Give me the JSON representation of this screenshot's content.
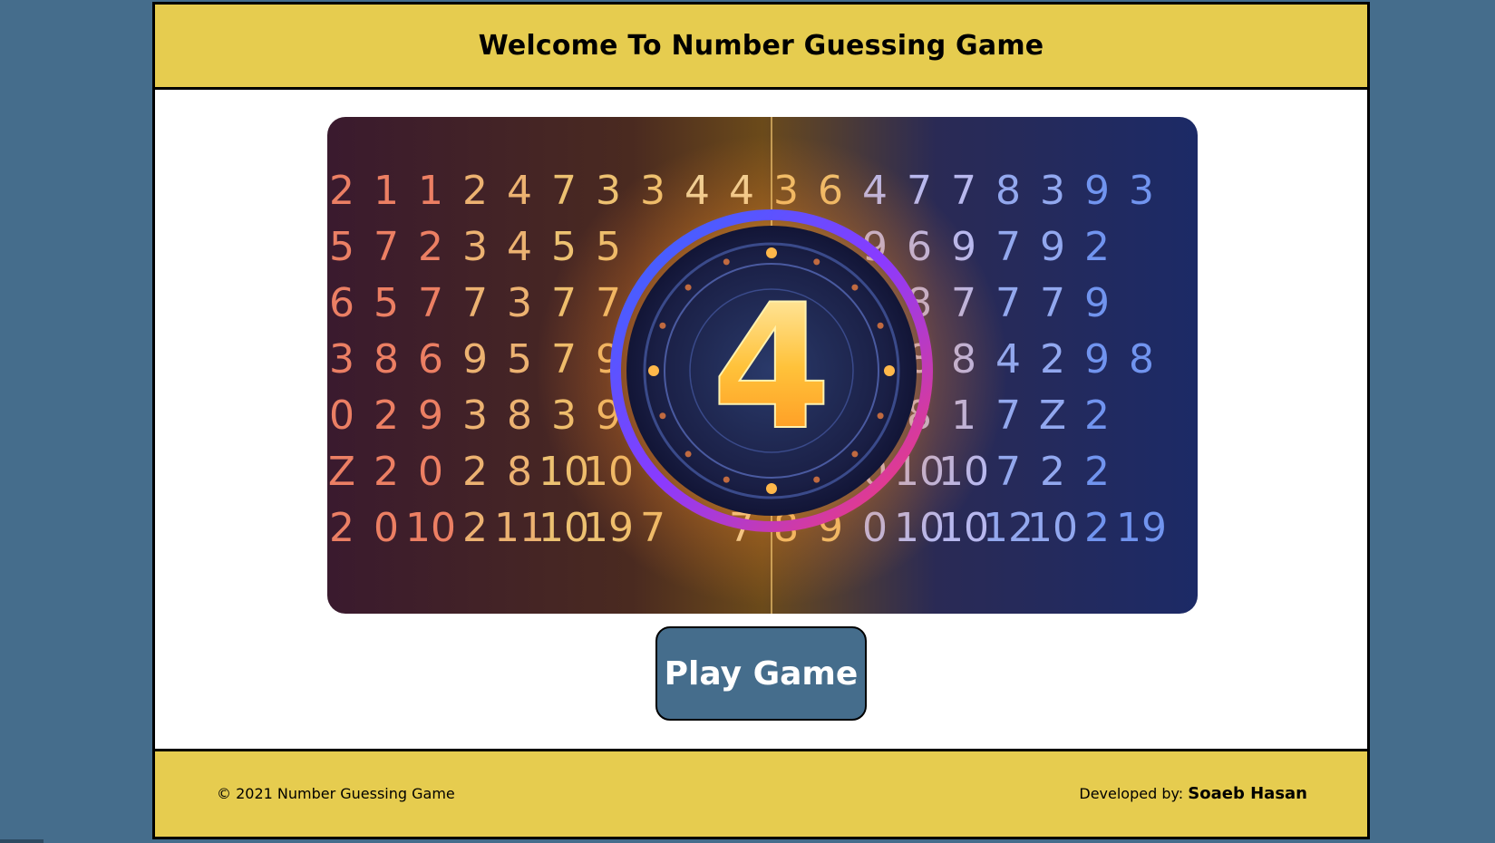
{
  "header": {
    "title": "Welcome To Number Guessing Game"
  },
  "hero": {
    "center_digit": "4",
    "rows": [
      [
        "2",
        "1",
        "1",
        "2",
        "4",
        "7",
        "3",
        "3",
        "4",
        "4",
        "3",
        "6",
        "4",
        "7",
        "7",
        "8",
        "3",
        "9",
        "3"
      ],
      [
        "5",
        "7",
        "2",
        "3",
        "4",
        "5",
        "5",
        "",
        "",
        "",
        "",
        "",
        "9",
        "6",
        "9",
        "7",
        "9",
        "2",
        ""
      ],
      [
        "6",
        "5",
        "7",
        "7",
        "3",
        "7",
        "7",
        "",
        "",
        "",
        "",
        "",
        "9",
        "8",
        "7",
        "7",
        "7",
        "9",
        ""
      ],
      [
        "3",
        "8",
        "6",
        "9",
        "5",
        "7",
        "9",
        "",
        "",
        "",
        "",
        "",
        "5",
        "8",
        "8",
        "4",
        "2",
        "9",
        "8"
      ],
      [
        "0",
        "2",
        "9",
        "3",
        "8",
        "3",
        "9",
        "",
        "",
        "",
        "",
        "",
        "0",
        "8",
        "1",
        "7",
        "Z",
        "2",
        ""
      ],
      [
        "Z",
        "2",
        "0",
        "2",
        "8",
        "10",
        "10",
        "",
        "",
        "",
        "",
        "",
        "0",
        "10",
        "10",
        "7",
        "2",
        "2",
        ""
      ],
      [
        "2",
        "0",
        "10",
        "2",
        "11",
        "10",
        "19",
        "7",
        "",
        "7",
        "8",
        "9",
        "0",
        "10",
        "10",
        "12",
        "10",
        "2",
        "19"
      ]
    ],
    "colors": {
      "bg_dark": "#2a1f3d",
      "glow": "#ffb84a",
      "ring_blue": "#2f6bff",
      "ring_red": "#ff3a6a",
      "digit_gold": "#ffd27a"
    }
  },
  "play_button": {
    "label": "Play Game"
  },
  "footer": {
    "copyright": "© 2021 Number Guessing Game",
    "developer_prefix": "Developed by: ",
    "developer_name": "Soaeb Hasan"
  },
  "theme": {
    "page_bg": "#456d8c",
    "bar_bg": "#e6cc4f",
    "button_bg": "#456d8c"
  }
}
